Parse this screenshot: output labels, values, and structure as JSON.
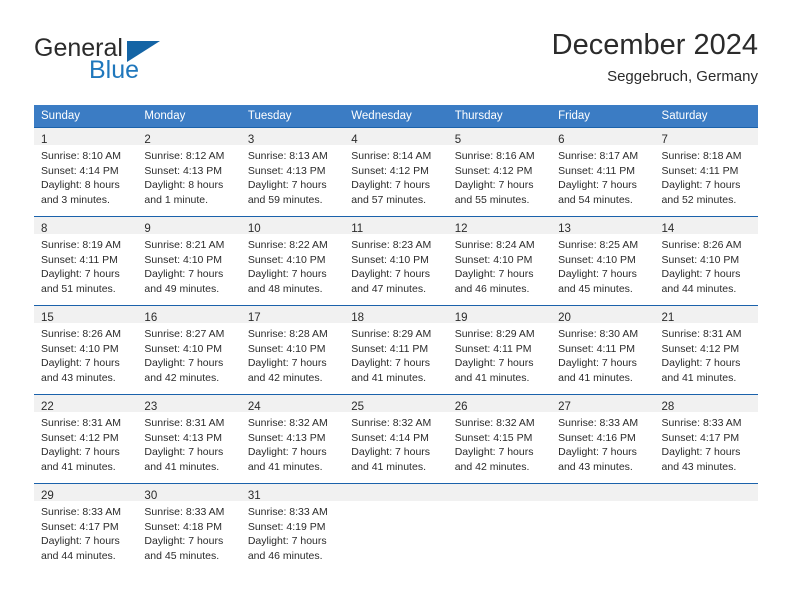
{
  "brand": {
    "name_part1": "General",
    "name_part2": "Blue",
    "flag_icon": "blue-triangle-flag-icon",
    "accent_color": "#1464a5"
  },
  "header": {
    "title": "December 2024",
    "subtitle": "Seggebruch, Germany"
  },
  "colors": {
    "header_blue": "#3b7cc4",
    "row_divider_blue": "#1b62ab",
    "daynum_band_gray": "#f1f1f1",
    "text": "#2b2b2b"
  },
  "calendar": {
    "weekday_headers": [
      "Sunday",
      "Monday",
      "Tuesday",
      "Wednesday",
      "Thursday",
      "Friday",
      "Saturday"
    ],
    "weeks": [
      [
        {
          "day": "1",
          "sunrise": "Sunrise: 8:10 AM",
          "sunset": "Sunset: 4:14 PM",
          "daylight_line1": "Daylight: 8 hours",
          "daylight_line2": "and 3 minutes."
        },
        {
          "day": "2",
          "sunrise": "Sunrise: 8:12 AM",
          "sunset": "Sunset: 4:13 PM",
          "daylight_line1": "Daylight: 8 hours",
          "daylight_line2": "and 1 minute."
        },
        {
          "day": "3",
          "sunrise": "Sunrise: 8:13 AM",
          "sunset": "Sunset: 4:13 PM",
          "daylight_line1": "Daylight: 7 hours",
          "daylight_line2": "and 59 minutes."
        },
        {
          "day": "4",
          "sunrise": "Sunrise: 8:14 AM",
          "sunset": "Sunset: 4:12 PM",
          "daylight_line1": "Daylight: 7 hours",
          "daylight_line2": "and 57 minutes."
        },
        {
          "day": "5",
          "sunrise": "Sunrise: 8:16 AM",
          "sunset": "Sunset: 4:12 PM",
          "daylight_line1": "Daylight: 7 hours",
          "daylight_line2": "and 55 minutes."
        },
        {
          "day": "6",
          "sunrise": "Sunrise: 8:17 AM",
          "sunset": "Sunset: 4:11 PM",
          "daylight_line1": "Daylight: 7 hours",
          "daylight_line2": "and 54 minutes."
        },
        {
          "day": "7",
          "sunrise": "Sunrise: 8:18 AM",
          "sunset": "Sunset: 4:11 PM",
          "daylight_line1": "Daylight: 7 hours",
          "daylight_line2": "and 52 minutes."
        }
      ],
      [
        {
          "day": "8",
          "sunrise": "Sunrise: 8:19 AM",
          "sunset": "Sunset: 4:11 PM",
          "daylight_line1": "Daylight: 7 hours",
          "daylight_line2": "and 51 minutes."
        },
        {
          "day": "9",
          "sunrise": "Sunrise: 8:21 AM",
          "sunset": "Sunset: 4:10 PM",
          "daylight_line1": "Daylight: 7 hours",
          "daylight_line2": "and 49 minutes."
        },
        {
          "day": "10",
          "sunrise": "Sunrise: 8:22 AM",
          "sunset": "Sunset: 4:10 PM",
          "daylight_line1": "Daylight: 7 hours",
          "daylight_line2": "and 48 minutes."
        },
        {
          "day": "11",
          "sunrise": "Sunrise: 8:23 AM",
          "sunset": "Sunset: 4:10 PM",
          "daylight_line1": "Daylight: 7 hours",
          "daylight_line2": "and 47 minutes."
        },
        {
          "day": "12",
          "sunrise": "Sunrise: 8:24 AM",
          "sunset": "Sunset: 4:10 PM",
          "daylight_line1": "Daylight: 7 hours",
          "daylight_line2": "and 46 minutes."
        },
        {
          "day": "13",
          "sunrise": "Sunrise: 8:25 AM",
          "sunset": "Sunset: 4:10 PM",
          "daylight_line1": "Daylight: 7 hours",
          "daylight_line2": "and 45 minutes."
        },
        {
          "day": "14",
          "sunrise": "Sunrise: 8:26 AM",
          "sunset": "Sunset: 4:10 PM",
          "daylight_line1": "Daylight: 7 hours",
          "daylight_line2": "and 44 minutes."
        }
      ],
      [
        {
          "day": "15",
          "sunrise": "Sunrise: 8:26 AM",
          "sunset": "Sunset: 4:10 PM",
          "daylight_line1": "Daylight: 7 hours",
          "daylight_line2": "and 43 minutes."
        },
        {
          "day": "16",
          "sunrise": "Sunrise: 8:27 AM",
          "sunset": "Sunset: 4:10 PM",
          "daylight_line1": "Daylight: 7 hours",
          "daylight_line2": "and 42 minutes."
        },
        {
          "day": "17",
          "sunrise": "Sunrise: 8:28 AM",
          "sunset": "Sunset: 4:10 PM",
          "daylight_line1": "Daylight: 7 hours",
          "daylight_line2": "and 42 minutes."
        },
        {
          "day": "18",
          "sunrise": "Sunrise: 8:29 AM",
          "sunset": "Sunset: 4:11 PM",
          "daylight_line1": "Daylight: 7 hours",
          "daylight_line2": "and 41 minutes."
        },
        {
          "day": "19",
          "sunrise": "Sunrise: 8:29 AM",
          "sunset": "Sunset: 4:11 PM",
          "daylight_line1": "Daylight: 7 hours",
          "daylight_line2": "and 41 minutes."
        },
        {
          "day": "20",
          "sunrise": "Sunrise: 8:30 AM",
          "sunset": "Sunset: 4:11 PM",
          "daylight_line1": "Daylight: 7 hours",
          "daylight_line2": "and 41 minutes."
        },
        {
          "day": "21",
          "sunrise": "Sunrise: 8:31 AM",
          "sunset": "Sunset: 4:12 PM",
          "daylight_line1": "Daylight: 7 hours",
          "daylight_line2": "and 41 minutes."
        }
      ],
      [
        {
          "day": "22",
          "sunrise": "Sunrise: 8:31 AM",
          "sunset": "Sunset: 4:12 PM",
          "daylight_line1": "Daylight: 7 hours",
          "daylight_line2": "and 41 minutes."
        },
        {
          "day": "23",
          "sunrise": "Sunrise: 8:31 AM",
          "sunset": "Sunset: 4:13 PM",
          "daylight_line1": "Daylight: 7 hours",
          "daylight_line2": "and 41 minutes."
        },
        {
          "day": "24",
          "sunrise": "Sunrise: 8:32 AM",
          "sunset": "Sunset: 4:13 PM",
          "daylight_line1": "Daylight: 7 hours",
          "daylight_line2": "and 41 minutes."
        },
        {
          "day": "25",
          "sunrise": "Sunrise: 8:32 AM",
          "sunset": "Sunset: 4:14 PM",
          "daylight_line1": "Daylight: 7 hours",
          "daylight_line2": "and 41 minutes."
        },
        {
          "day": "26",
          "sunrise": "Sunrise: 8:32 AM",
          "sunset": "Sunset: 4:15 PM",
          "daylight_line1": "Daylight: 7 hours",
          "daylight_line2": "and 42 minutes."
        },
        {
          "day": "27",
          "sunrise": "Sunrise: 8:33 AM",
          "sunset": "Sunset: 4:16 PM",
          "daylight_line1": "Daylight: 7 hours",
          "daylight_line2": "and 43 minutes."
        },
        {
          "day": "28",
          "sunrise": "Sunrise: 8:33 AM",
          "sunset": "Sunset: 4:17 PM",
          "daylight_line1": "Daylight: 7 hours",
          "daylight_line2": "and 43 minutes."
        }
      ],
      [
        {
          "day": "29",
          "sunrise": "Sunrise: 8:33 AM",
          "sunset": "Sunset: 4:17 PM",
          "daylight_line1": "Daylight: 7 hours",
          "daylight_line2": "and 44 minutes."
        },
        {
          "day": "30",
          "sunrise": "Sunrise: 8:33 AM",
          "sunset": "Sunset: 4:18 PM",
          "daylight_line1": "Daylight: 7 hours",
          "daylight_line2": "and 45 minutes."
        },
        {
          "day": "31",
          "sunrise": "Sunrise: 8:33 AM",
          "sunset": "Sunset: 4:19 PM",
          "daylight_line1": "Daylight: 7 hours",
          "daylight_line2": "and 46 minutes."
        },
        {
          "day": "",
          "sunrise": "",
          "sunset": "",
          "daylight_line1": "",
          "daylight_line2": ""
        },
        {
          "day": "",
          "sunrise": "",
          "sunset": "",
          "daylight_line1": "",
          "daylight_line2": ""
        },
        {
          "day": "",
          "sunrise": "",
          "sunset": "",
          "daylight_line1": "",
          "daylight_line2": ""
        },
        {
          "day": "",
          "sunrise": "",
          "sunset": "",
          "daylight_line1": "",
          "daylight_line2": ""
        }
      ]
    ]
  }
}
